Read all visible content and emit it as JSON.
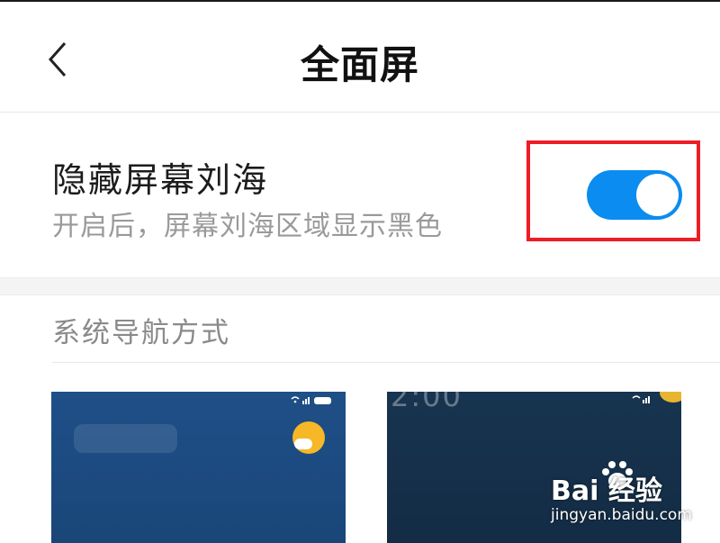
{
  "header": {
    "title": "全面屏"
  },
  "notch_setting": {
    "title": "隐藏屏幕刘海",
    "subtitle": "开启后，屏幕刘海区域显示黑色",
    "enabled": true
  },
  "navigation": {
    "section_title": "系统导航方式"
  },
  "colors": {
    "accent": "#0a8cf0",
    "highlight": "#ee1c25"
  },
  "watermark": {
    "brand": "Bai  经验",
    "url": "jingyan.baidu.com"
  }
}
